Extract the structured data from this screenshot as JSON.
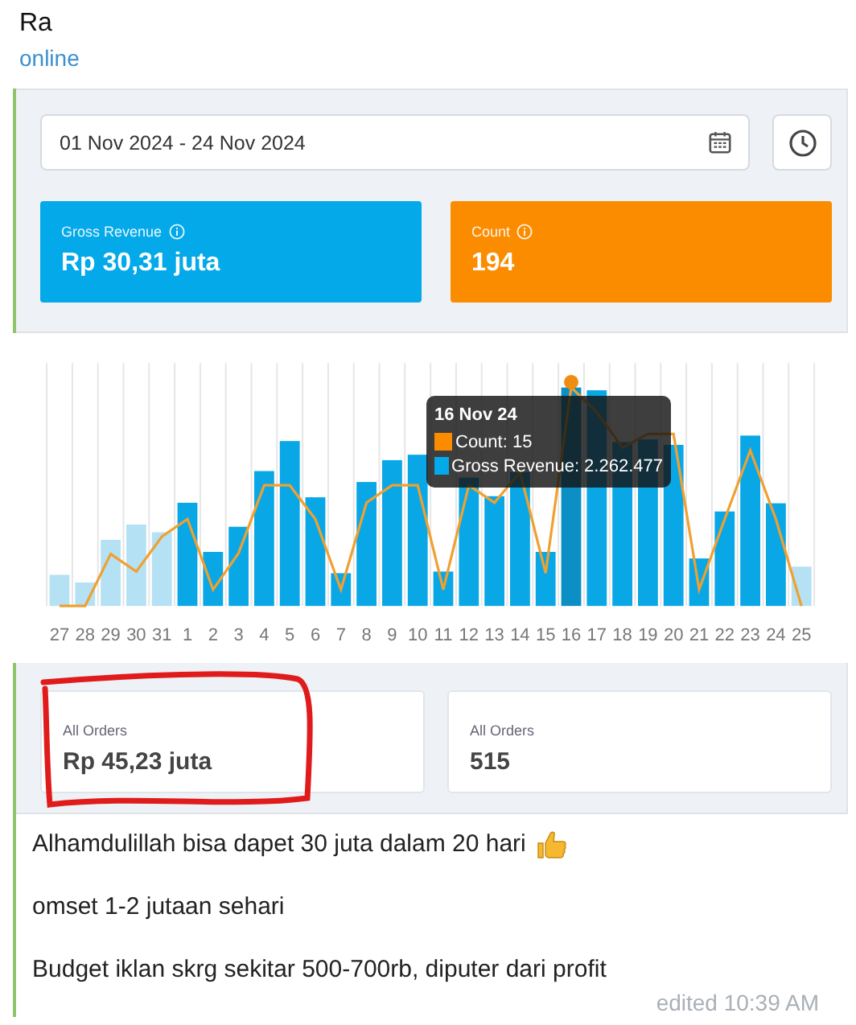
{
  "chat": {
    "name": "Ra",
    "status": "online"
  },
  "dashboard": {
    "date_range": "01 Nov 2024 - 24 Nov 2024",
    "metrics": [
      {
        "label": "Gross Revenue",
        "value": "Rp 30,31 juta",
        "color": "#03a9e8"
      },
      {
        "label": "Count",
        "value": "194",
        "color": "#fb8c00"
      }
    ],
    "chart": {
      "x_labels": [
        "27",
        "28",
        "29",
        "30",
        "31",
        "1",
        "2",
        "3",
        "4",
        "5",
        "6",
        "7",
        "8",
        "9",
        "10",
        "11",
        "12",
        "13",
        "14",
        "15",
        "16",
        "17",
        "18",
        "19",
        "20",
        "21",
        "22",
        "23",
        "24",
        "25"
      ],
      "tooltip": {
        "title": "16 Nov 24",
        "rows": [
          {
            "label": "Count: 15",
            "color": "#fb8c00"
          },
          {
            "label": "Gross Revenue: 2.262.477",
            "color": "#03a9e8"
          }
        ]
      }
    },
    "totals": [
      {
        "label": "All Orders",
        "value": "Rp 45,23 juta",
        "circled": true
      },
      {
        "label": "All Orders",
        "value": "515",
        "circled": false
      }
    ]
  },
  "message": {
    "lines": [
      "Alhamdulillah bisa dapet 30 juta dalam 20 hari",
      "omset 1-2 jutaan sehari",
      "Budget iklan skrg sekitar 500-700rb, diputer dari profit"
    ],
    "edited": "edited 10:39 AM"
  }
}
